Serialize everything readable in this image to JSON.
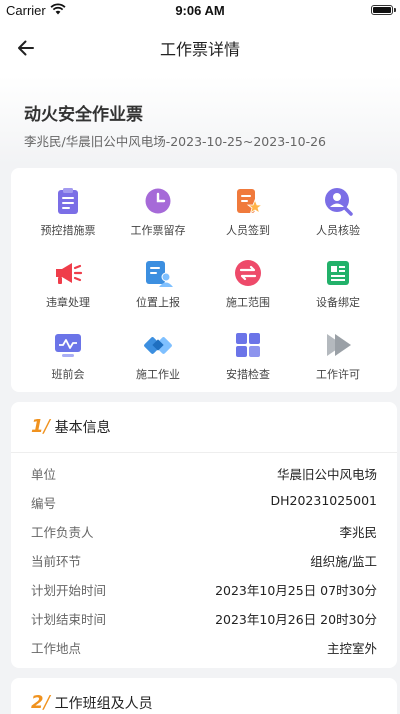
{
  "status_bar": {
    "carrier": "Carrier",
    "time": "9:06 AM"
  },
  "nav": {
    "title": "工作票详情",
    "back_icon": "arrow-left-icon"
  },
  "ticket": {
    "title": "动火安全作业票",
    "subtitle": "李兆民/华晨旧公中风电场-2023-10-25~2023-10-26"
  },
  "actions": [
    {
      "label": "预控措施票",
      "icon": "clipboard-list-icon",
      "color": "#7b6ee6"
    },
    {
      "label": "工作票留存",
      "icon": "clock-icon",
      "color": "#a66ad8"
    },
    {
      "label": "人员签到",
      "icon": "signin-doc-icon",
      "color": "#f07a3c"
    },
    {
      "label": "人员核验",
      "icon": "user-search-icon",
      "color": "#7b6ee6"
    },
    {
      "label": "违章处理",
      "icon": "megaphone-icon",
      "color": "#ef3d4a"
    },
    {
      "label": "位置上报",
      "icon": "location-report-icon",
      "color": "#3c8fe0"
    },
    {
      "label": "施工范围",
      "icon": "exchange-icon",
      "color": "#ee4a6a"
    },
    {
      "label": "设备绑定",
      "icon": "device-bind-icon",
      "color": "#22b16a"
    },
    {
      "label": "班前会",
      "icon": "monitor-icon",
      "color": "#6b74e8"
    },
    {
      "label": "施工作业",
      "icon": "construction-icon",
      "color": "#3c8fe0"
    },
    {
      "label": "安措检查",
      "icon": "grid-check-icon",
      "color": "#6b74e8"
    },
    {
      "label": "工作许可",
      "icon": "play-permit-icon",
      "color": "#9aa0a6"
    }
  ],
  "basic_info": {
    "number": "1",
    "title": "基本信息",
    "rows": [
      {
        "label": "单位",
        "value": "华晨旧公中风电场"
      },
      {
        "label": "编号",
        "value": "DH20231025001"
      },
      {
        "label": "工作负责人",
        "value": "李兆民"
      },
      {
        "label": "当前环节",
        "value": "组织施/监工"
      },
      {
        "label": "计划开始时间",
        "value": "2023年10月25日 07时30分"
      },
      {
        "label": "计划结束时间",
        "value": "2023年10月26日 20时30分"
      },
      {
        "label": "工作地点",
        "value": "主控室外"
      }
    ]
  },
  "crew": {
    "number": "2",
    "title": "工作班组及人员"
  },
  "colors": {
    "accent": "#f0921e",
    "background": "#f2f3f5"
  }
}
